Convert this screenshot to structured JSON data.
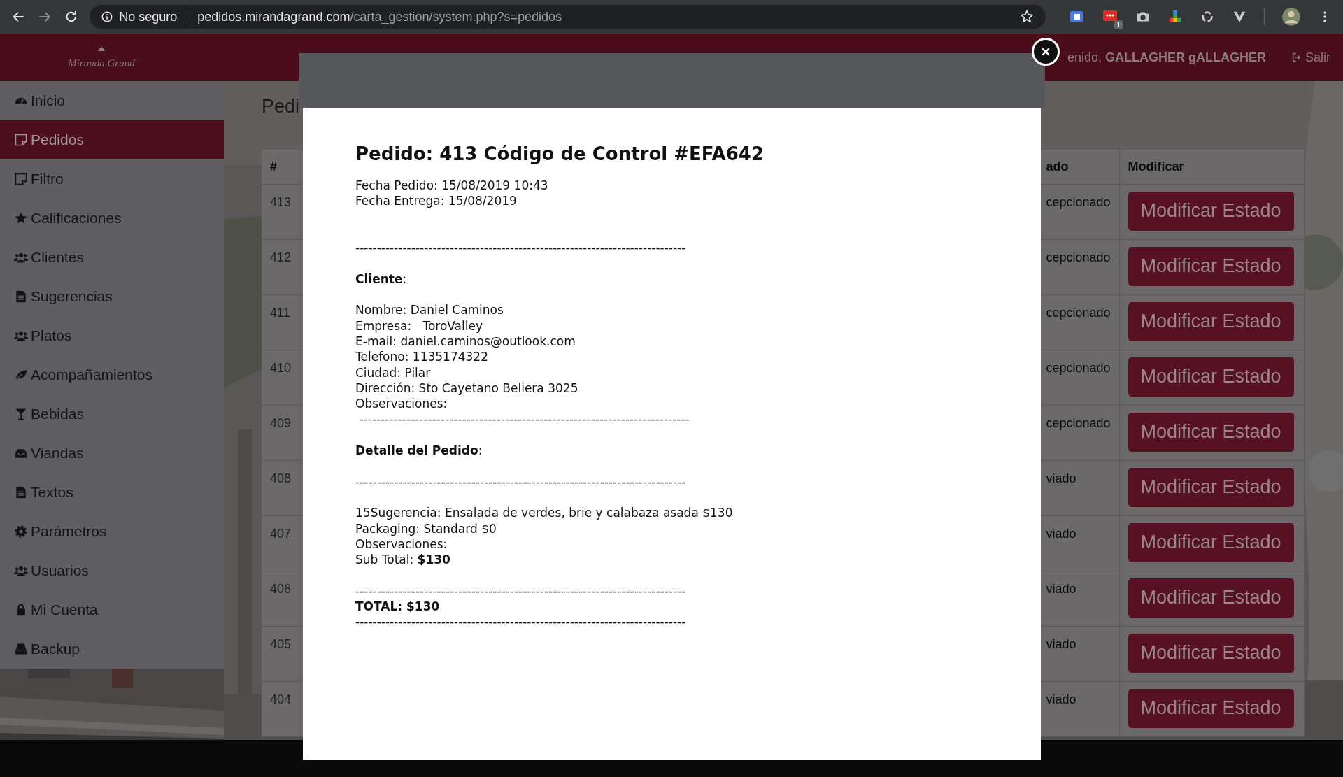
{
  "browser": {
    "security": "No seguro",
    "url_host": "pedidos.mirandagrand.com",
    "url_path": "/carta_gestion/system.php?s=pedidos",
    "extension_badge": "1"
  },
  "header": {
    "logo": "Miranda Grand",
    "greeting": "enido,",
    "user": "GALLAGHER gALLAGHER",
    "logout": "Salir"
  },
  "sidebar": {
    "items": [
      {
        "label": "Inicio",
        "selected": false
      },
      {
        "label": "Pedidos",
        "selected": true
      },
      {
        "label": "Filtro",
        "selected": false
      },
      {
        "label": "Calificaciones",
        "selected": false
      },
      {
        "label": "Clientes",
        "selected": false
      },
      {
        "label": "Sugerencias",
        "selected": false
      },
      {
        "label": "Platos",
        "selected": false
      },
      {
        "label": "Acompañamientos",
        "selected": false
      },
      {
        "label": "Bebidas",
        "selected": false
      },
      {
        "label": "Viandas",
        "selected": false
      },
      {
        "label": "Textos",
        "selected": false
      },
      {
        "label": "Parámetros",
        "selected": false
      },
      {
        "label": "Usuarios",
        "selected": false
      },
      {
        "label": "Mi Cuenta",
        "selected": false
      },
      {
        "label": "Backup",
        "selected": false
      }
    ]
  },
  "page": {
    "title": "Pedi",
    "table": {
      "columns": [
        "#",
        "ado",
        "Modificar"
      ],
      "rows": [
        {
          "id": "413",
          "estado": "cepcionado",
          "action": "Modificar Estado"
        },
        {
          "id": "412",
          "estado": "cepcionado",
          "action": "Modificar Estado"
        },
        {
          "id": "411",
          "estado": "cepcionado",
          "action": "Modificar Estado"
        },
        {
          "id": "410",
          "estado": "cepcionado",
          "action": "Modificar Estado"
        },
        {
          "id": "409",
          "estado": "cepcionado",
          "action": "Modificar Estado"
        },
        {
          "id": "408",
          "estado": "viado",
          "action": "Modificar Estado"
        },
        {
          "id": "407",
          "estado": "viado",
          "action": "Modificar Estado"
        },
        {
          "id": "406",
          "estado": "viado",
          "action": "Modificar Estado"
        },
        {
          "id": "405",
          "estado": "viado",
          "action": "Modificar Estado"
        },
        {
          "id": "404",
          "estado": "viado",
          "action": "Modificar Estado"
        }
      ]
    }
  },
  "modal": {
    "lines": [
      {
        "kind": "title",
        "text": "Pedido: 413 Código de Control #EFA642"
      },
      {
        "kind": "text",
        "text": "Fecha Pedido: 15/08/2019 10:43"
      },
      {
        "kind": "text",
        "text": "Fecha Entrega: 15/08/2019"
      },
      {
        "kind": "blank"
      },
      {
        "kind": "blank"
      },
      {
        "kind": "rule",
        "text": "-----------------------------------------------------------------------------"
      },
      {
        "kind": "blank"
      },
      {
        "kind": "text",
        "text": "**Cliente**:"
      },
      {
        "kind": "blank"
      },
      {
        "kind": "text",
        "text": "Nombre: Daniel Caminos"
      },
      {
        "kind": "text",
        "text": "Empresa:   ToroValley"
      },
      {
        "kind": "text",
        "text": "E-mail: daniel.caminos@outlook.com"
      },
      {
        "kind": "text",
        "text": "Telefono: 1135174322"
      },
      {
        "kind": "text",
        "text": "Ciudad: Pilar"
      },
      {
        "kind": "text",
        "text": "Dirección: Sto Cayetano Beliera 3025"
      },
      {
        "kind": "text",
        "text": "Observaciones:"
      },
      {
        "kind": "rule",
        "text": " -----------------------------------------------------------------------------"
      },
      {
        "kind": "blank"
      },
      {
        "kind": "text",
        "text": "**Detalle del Pedido**:"
      },
      {
        "kind": "blank"
      },
      {
        "kind": "rule",
        "text": "-----------------------------------------------------------------------------"
      },
      {
        "kind": "blank"
      },
      {
        "kind": "text",
        "text": "15Sugerencia: Ensalada de verdes, brie y calabaza asada $130"
      },
      {
        "kind": "text",
        "text": "Packaging: Standard $0"
      },
      {
        "kind": "text",
        "text": "Observaciones:"
      },
      {
        "kind": "text",
        "text": "Sub Total: **$130**"
      },
      {
        "kind": "blank"
      },
      {
        "kind": "rule",
        "text": "-----------------------------------------------------------------------------"
      },
      {
        "kind": "total",
        "text": "TOTAL: $130"
      },
      {
        "kind": "rule",
        "text": "-----------------------------------------------------------------------------"
      }
    ]
  }
}
